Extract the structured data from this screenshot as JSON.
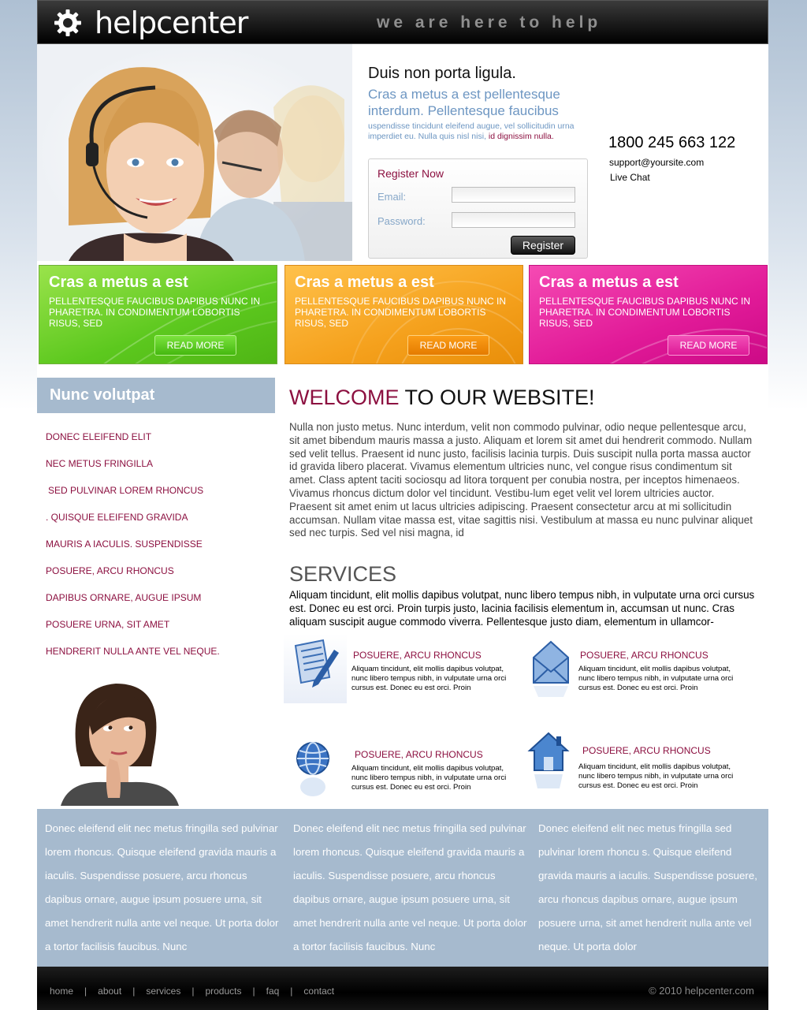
{
  "header": {
    "logo_text": "helpcenter",
    "tagline": "we are here to help"
  },
  "hero": {
    "heading": "Duis non porta ligula.",
    "subheading": "Cras a metus a est pellentesque interdum. Pellentesque faucibus",
    "text": "uspendisse tincidunt eleifend augue, vel sollicitudin urna imperdiet eu. Nulla quis nisl nisi,",
    "text_highlight": "id dignissim nulla."
  },
  "register": {
    "title": "Register Now",
    "email_label": "Email:",
    "password_label": "Password:",
    "button": "Register"
  },
  "contact": {
    "phone": "1800 245 663 122",
    "email": "support@yoursite.com",
    "chat": "Live Chat"
  },
  "promos": [
    {
      "title": "Cras a metus a est",
      "text": "PELLENTESQUE FAUCIBUS DAPIBUS NUNC IN PHARETRA. IN CONDIMENTUM LOBORTIS RISUS, SED",
      "button": "READ MORE"
    },
    {
      "title": "Cras a metus a est",
      "text": "PELLENTESQUE FAUCIBUS DAPIBUS NUNC IN PHARETRA. IN CONDIMENTUM LOBORTIS RISUS, SED",
      "button": "READ MORE"
    },
    {
      "title": "Cras a metus a est",
      "text": "PELLENTESQUE FAUCIBUS DAPIBUS NUNC IN PHARETRA. IN CONDIMENTUM LOBORTIS RISUS, SED",
      "button": "READ MORE"
    }
  ],
  "sidebar": {
    "title": "Nunc volutpat",
    "items": [
      "DONEC ELEIFEND ELIT",
      "NEC METUS FRINGILLA",
      "SED PULVINAR LOREM RHONCUS",
      ". QUISQUE ELEIFEND GRAVIDA",
      "MAURIS A IACULIS. SUSPENDISSE",
      "POSUERE, ARCU RHONCUS",
      "DAPIBUS ORNARE, AUGUE IPSUM",
      "POSUERE URNA, SIT AMET",
      "HENDRERIT NULLA ANTE VEL NEQUE."
    ]
  },
  "welcome": {
    "accent": "WELCOME",
    "rest": " TO OUR WEBSITE!",
    "text": "Nulla non justo metus. Nunc interdum, velit non commodo pulvinar, odio neque pellentesque arcu, sit amet bibendum mauris massa a justo. Aliquam et lorem sit amet dui hendrerit commodo. Nullam sed velit tellus. Praesent id nunc justo, facilisis lacinia turpis. Duis suscipit nulla porta massa auctor id gravida libero placerat. Vivamus elementum ultricies nunc, vel congue risus condimentum sit amet. Class aptent taciti sociosqu ad litora torquent per conubia nostra, per inceptos himenaeos. Vivamus rhoncus dictum dolor vel tincidunt. Vestibu-lum eget velit vel lorem ultricies auctor. Praesent sit amet enim ut lacus ultricies adipiscing. Praesent consectetur arcu at mi sollicitudin accumsan. Nullam vitae massa est, vitae sagittis nisi. Vestibulum at massa eu nunc pulvinar aliquet sed nec turpis. Sed vel nisi magna, id"
  },
  "services": {
    "heading": "SERVICES",
    "text": "Aliquam tincidunt, elit mollis dapibus volutpat, nunc libero tempus nibh, in vulputate urna orci cursus est. Donec eu est orci. Proin turpis justo, lacinia facilisis elementum in, accumsan ut nunc. Cras aliquam suscipit augue commodo viverra. Pellentesque justo diam, elementum in ullamcor-",
    "items": [
      {
        "icon": "document-pen-icon",
        "title": "POSUERE, ARCU RHONCUS",
        "text": "Aliquam tincidunt, elit mollis dapibus volutpat, nunc libero tempus nibh, in vulputate urna orci cursus est. Donec eu est orci. Proin"
      },
      {
        "icon": "envelope-icon",
        "title": "POSUERE, ARCU RHONCUS",
        "text": "Aliquam tincidunt, elit mollis dapibus volutpat, nunc libero tempus nibh, in vulputate urna orci cursus est. Donec eu est orci. Proin"
      },
      {
        "icon": "globe-icon",
        "title": "POSUERE, ARCU RHONCUS",
        "text": "Aliquam tincidunt, elit mollis dapibus volutpat, nunc libero tempus nibh, in vulputate urna orci cursus est. Donec eu est orci. Proin"
      },
      {
        "icon": "home-icon",
        "title": "POSUERE, ARCU RHONCUS",
        "text": "Aliquam tincidunt, elit mollis dapibus volutpat, nunc libero tempus nibh, in vulputate urna orci cursus est. Donec eu est orci. Proin"
      }
    ]
  },
  "footer_columns": [
    "Donec eleifend elit nec metus fringilla sed pulvinar lorem rhoncus. Quisque eleifend gravida mauris a iaculis. Suspendisse posuere, arcu rhoncus dapibus ornare, augue ipsum posuere urna, sit amet hendrerit nulla ante vel neque. Ut porta dolor a tortor facilisis faucibus. Nunc",
    "Donec eleifend elit nec metus fringilla sed pulvinar lorem rhoncus. Quisque eleifend gravida mauris a iaculis. Suspendisse posuere, arcu rhoncus dapibus ornare, augue ipsum posuere urna, sit amet hendrerit nulla ante vel neque. Ut porta dolor a tortor facilisis faucibus. Nunc",
    "Donec eleifend elit nec metus fringilla sed pulvinar lorem rhoncu s. Quisque eleifend gravida mauris a iaculis. Suspendisse posuere, arcu rhoncus dapibus ornare, augue ipsum posuere urna, sit amet hendrerit nulla ante vel neque. Ut porta dolor"
  ],
  "nav": [
    "home",
    "about",
    "services",
    "products",
    "faq",
    "contact"
  ],
  "nav_separator": "|",
  "copyright": "© 2010 helpcenter.com",
  "colors": {
    "accent": "#8c1040",
    "hero_blue": "#6d96c2",
    "sidebar_bg": "#a6bace",
    "promo_green": "#5cc81e",
    "promo_orange": "#f5a11d",
    "promo_pink": "#e11a98"
  }
}
